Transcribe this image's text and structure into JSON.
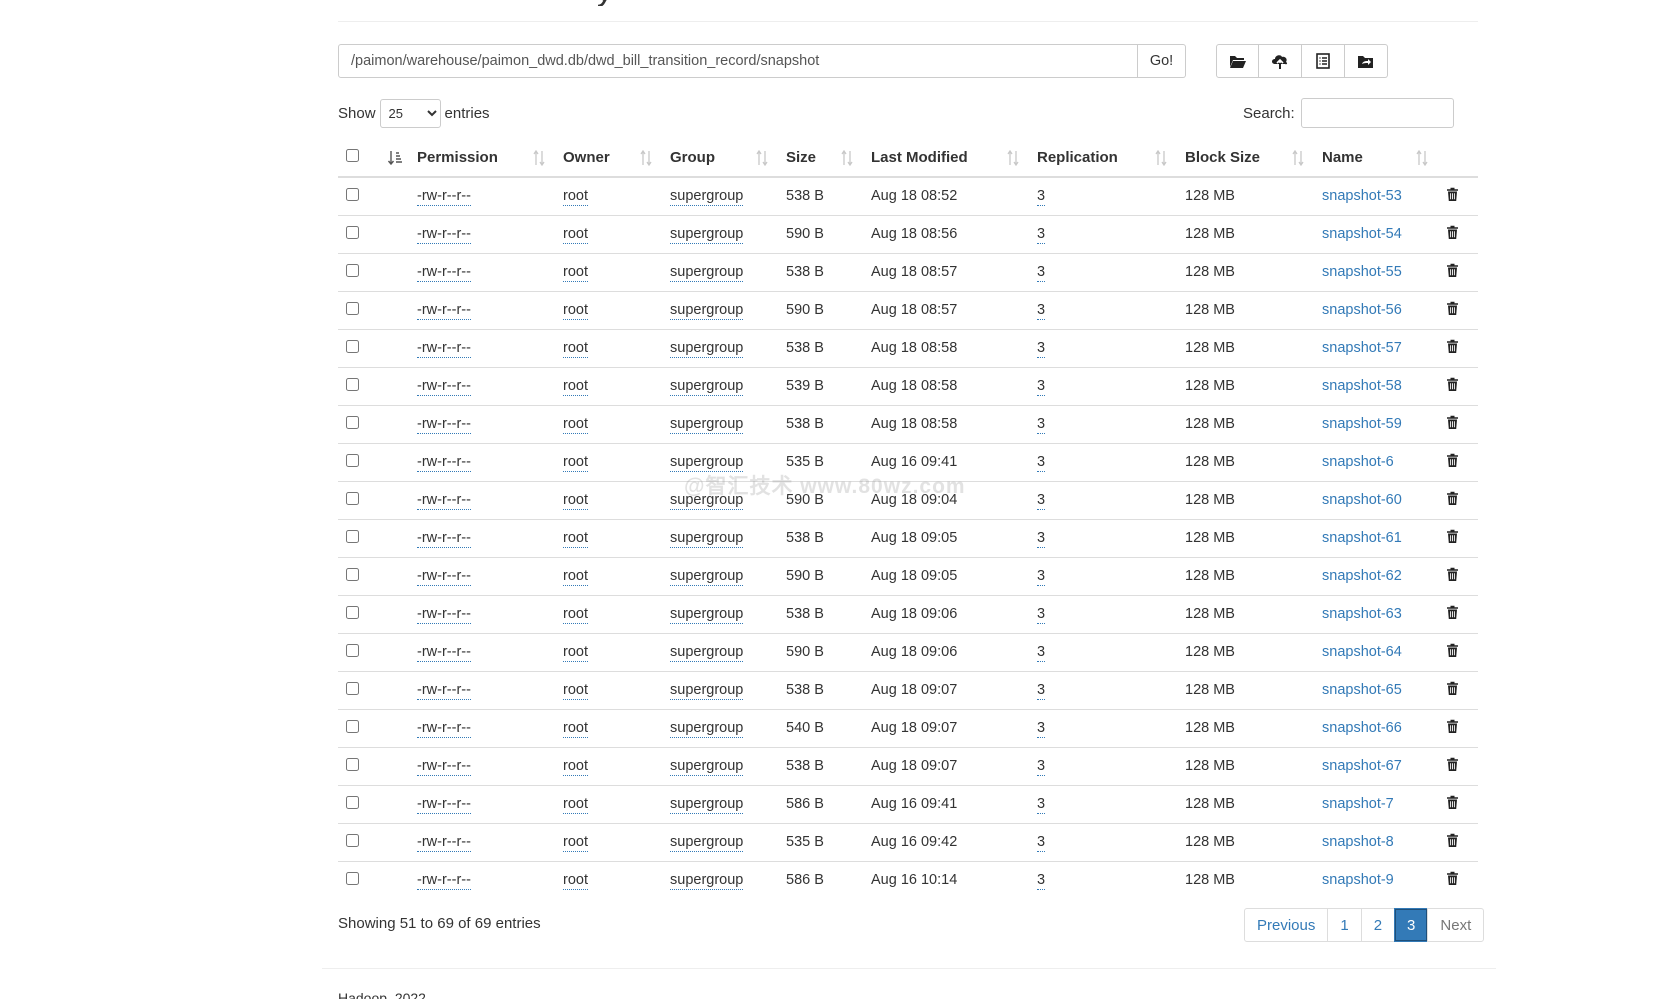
{
  "path_bar": {
    "path_value": "/paimon/warehouse/paimon_dwd.db/dwd_bill_transition_record/snapshot",
    "go_label": "Go!"
  },
  "toolbar": {
    "icons": [
      "folder-open-icon",
      "cloud-upload-icon",
      "list-icon",
      "folder-move-icon"
    ]
  },
  "length": {
    "show_label": "Show",
    "selected": "25",
    "entries_label": "entries"
  },
  "search": {
    "label": "Search:",
    "value": ""
  },
  "table": {
    "headers": {
      "permission": "Permission",
      "owner": "Owner",
      "group": "Group",
      "size": "Size",
      "last_modified": "Last Modified",
      "replication": "Replication",
      "block_size": "Block Size",
      "name": "Name"
    },
    "rows": [
      {
        "permission": "-rw-r--r--",
        "owner": "root",
        "group": "supergroup",
        "size": "538 B",
        "modified": "Aug 18 08:52",
        "replication": "3",
        "block_size": "128 MB",
        "name": "snapshot-53"
      },
      {
        "permission": "-rw-r--r--",
        "owner": "root",
        "group": "supergroup",
        "size": "590 B",
        "modified": "Aug 18 08:56",
        "replication": "3",
        "block_size": "128 MB",
        "name": "snapshot-54"
      },
      {
        "permission": "-rw-r--r--",
        "owner": "root",
        "group": "supergroup",
        "size": "538 B",
        "modified": "Aug 18 08:57",
        "replication": "3",
        "block_size": "128 MB",
        "name": "snapshot-55"
      },
      {
        "permission": "-rw-r--r--",
        "owner": "root",
        "group": "supergroup",
        "size": "590 B",
        "modified": "Aug 18 08:57",
        "replication": "3",
        "block_size": "128 MB",
        "name": "snapshot-56"
      },
      {
        "permission": "-rw-r--r--",
        "owner": "root",
        "group": "supergroup",
        "size": "538 B",
        "modified": "Aug 18 08:58",
        "replication": "3",
        "block_size": "128 MB",
        "name": "snapshot-57"
      },
      {
        "permission": "-rw-r--r--",
        "owner": "root",
        "group": "supergroup",
        "size": "539 B",
        "modified": "Aug 18 08:58",
        "replication": "3",
        "block_size": "128 MB",
        "name": "snapshot-58"
      },
      {
        "permission": "-rw-r--r--",
        "owner": "root",
        "group": "supergroup",
        "size": "538 B",
        "modified": "Aug 18 08:58",
        "replication": "3",
        "block_size": "128 MB",
        "name": "snapshot-59"
      },
      {
        "permission": "-rw-r--r--",
        "owner": "root",
        "group": "supergroup",
        "size": "535 B",
        "modified": "Aug 16 09:41",
        "replication": "3",
        "block_size": "128 MB",
        "name": "snapshot-6"
      },
      {
        "permission": "-rw-r--r--",
        "owner": "root",
        "group": "supergroup",
        "size": "590 B",
        "modified": "Aug 18 09:04",
        "replication": "3",
        "block_size": "128 MB",
        "name": "snapshot-60"
      },
      {
        "permission": "-rw-r--r--",
        "owner": "root",
        "group": "supergroup",
        "size": "538 B",
        "modified": "Aug 18 09:05",
        "replication": "3",
        "block_size": "128 MB",
        "name": "snapshot-61"
      },
      {
        "permission": "-rw-r--r--",
        "owner": "root",
        "group": "supergroup",
        "size": "590 B",
        "modified": "Aug 18 09:05",
        "replication": "3",
        "block_size": "128 MB",
        "name": "snapshot-62"
      },
      {
        "permission": "-rw-r--r--",
        "owner": "root",
        "group": "supergroup",
        "size": "538 B",
        "modified": "Aug 18 09:06",
        "replication": "3",
        "block_size": "128 MB",
        "name": "snapshot-63"
      },
      {
        "permission": "-rw-r--r--",
        "owner": "root",
        "group": "supergroup",
        "size": "590 B",
        "modified": "Aug 18 09:06",
        "replication": "3",
        "block_size": "128 MB",
        "name": "snapshot-64"
      },
      {
        "permission": "-rw-r--r--",
        "owner": "root",
        "group": "supergroup",
        "size": "538 B",
        "modified": "Aug 18 09:07",
        "replication": "3",
        "block_size": "128 MB",
        "name": "snapshot-65"
      },
      {
        "permission": "-rw-r--r--",
        "owner": "root",
        "group": "supergroup",
        "size": "540 B",
        "modified": "Aug 18 09:07",
        "replication": "3",
        "block_size": "128 MB",
        "name": "snapshot-66"
      },
      {
        "permission": "-rw-r--r--",
        "owner": "root",
        "group": "supergroup",
        "size": "538 B",
        "modified": "Aug 18 09:07",
        "replication": "3",
        "block_size": "128 MB",
        "name": "snapshot-67"
      },
      {
        "permission": "-rw-r--r--",
        "owner": "root",
        "group": "supergroup",
        "size": "586 B",
        "modified": "Aug 16 09:41",
        "replication": "3",
        "block_size": "128 MB",
        "name": "snapshot-7"
      },
      {
        "permission": "-rw-r--r--",
        "owner": "root",
        "group": "supergroup",
        "size": "535 B",
        "modified": "Aug 16 09:42",
        "replication": "3",
        "block_size": "128 MB",
        "name": "snapshot-8"
      },
      {
        "permission": "-rw-r--r--",
        "owner": "root",
        "group": "supergroup",
        "size": "586 B",
        "modified": "Aug 16 10:14",
        "replication": "3",
        "block_size": "128 MB",
        "name": "snapshot-9"
      }
    ]
  },
  "info": {
    "text": "Showing 51 to 69 of 69 entries"
  },
  "pagination": {
    "previous": "Previous",
    "pages": [
      "1",
      "2",
      "3"
    ],
    "active": "3",
    "next": "Next"
  },
  "footer": {
    "text": "Hadoop, 2022."
  },
  "watermark": {
    "text": "@智汇技术 www.80wz.com"
  },
  "colors": {
    "link": "#337ab7",
    "border": "#dddddd",
    "active_page": "#337ab7"
  }
}
